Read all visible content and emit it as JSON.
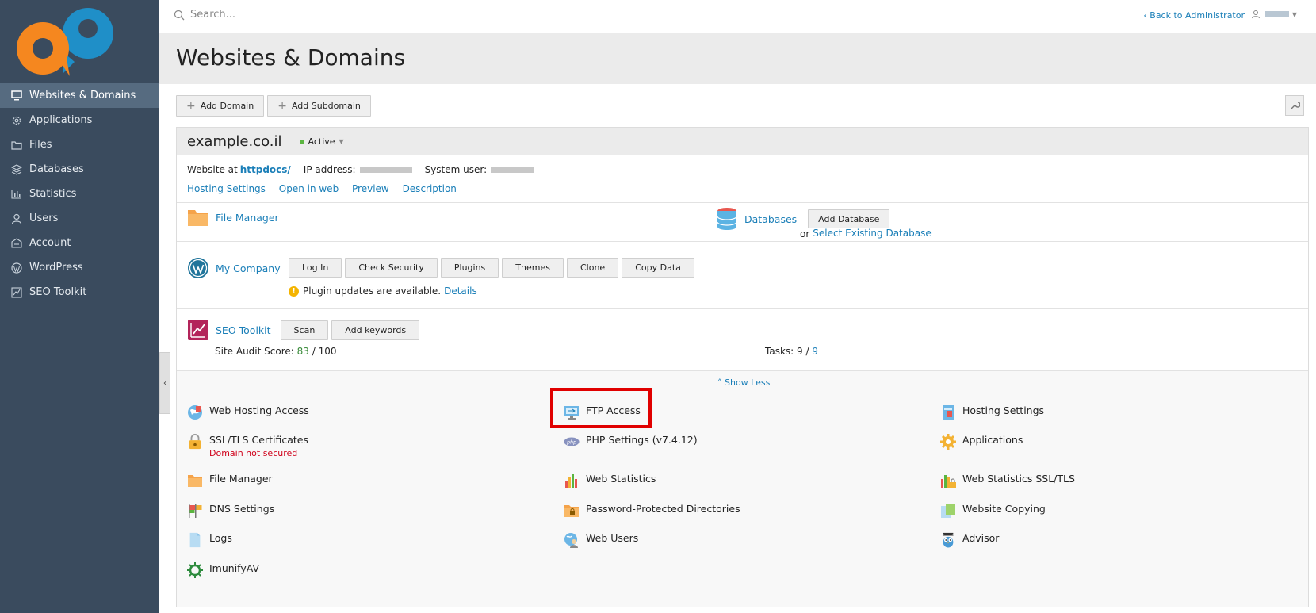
{
  "search": {
    "placeholder": "Search..."
  },
  "header": {
    "back_link": "‹ Back to Administrator"
  },
  "sidebar": {
    "items": [
      {
        "label": "Websites & Domains",
        "icon": "monitor-icon"
      },
      {
        "label": "Applications",
        "icon": "gear-icon"
      },
      {
        "label": "Files",
        "icon": "folder-icon"
      },
      {
        "label": "Databases",
        "icon": "database-icon"
      },
      {
        "label": "Statistics",
        "icon": "bar-chart-icon"
      },
      {
        "label": "Users",
        "icon": "user-icon"
      },
      {
        "label": "Account",
        "icon": "account-icon"
      },
      {
        "label": "WordPress",
        "icon": "wordpress-icon"
      },
      {
        "label": "SEO Toolkit",
        "icon": "seo-icon"
      }
    ]
  },
  "page": {
    "title": "Websites & Domains"
  },
  "toolbar": {
    "add_domain": "Add Domain",
    "add_subdomain": "Add Subdomain"
  },
  "domain": {
    "name": "example.co.il",
    "status": "Active",
    "website_at_label": "Website at",
    "website_path": "httpdocs/",
    "ip_label": "IP address:",
    "system_user_label": "System user:",
    "links": [
      "Hosting Settings",
      "Open in web",
      "Preview",
      "Description"
    ]
  },
  "tools": {
    "file_manager": "File Manager",
    "databases": "Databases",
    "add_database": "Add Database",
    "or": "or",
    "select_existing_database": "Select Existing Database"
  },
  "wordpress": {
    "site_name": "My Company",
    "buttons": [
      "Log In",
      "Check Security",
      "Plugins",
      "Themes",
      "Clone",
      "Copy Data"
    ],
    "notice": "Plugin updates are available.",
    "details": "Details"
  },
  "seo": {
    "label": "SEO Toolkit",
    "scan": "Scan",
    "add_keywords": "Add keywords",
    "audit_label": "Site Audit Score:",
    "audit_score": "83",
    "audit_total": "/ 100",
    "tasks_label": "Tasks:",
    "tasks_done": "9 /",
    "tasks_total": "9"
  },
  "show_less": "Show Less",
  "grid": {
    "col1": [
      {
        "label": "Web Hosting Access",
        "icon": "globe-icon"
      },
      {
        "label": "SSL/TLS Certificates",
        "icon": "lock-icon",
        "sub": "Domain not secured"
      },
      {
        "label": "File Manager",
        "icon": "folder-icon"
      },
      {
        "label": "DNS Settings",
        "icon": "flags-icon"
      },
      {
        "label": "Logs",
        "icon": "document-icon"
      },
      {
        "label": "ImunifyAV",
        "icon": "virus-shield-icon"
      }
    ],
    "col2": [
      {
        "label": "FTP Access",
        "icon": "ftp-monitor-icon"
      },
      {
        "label": "PHP Settings (v7.4.12)",
        "icon": "php-icon"
      },
      {
        "label": "Web Statistics",
        "icon": "bar-chart-icon"
      },
      {
        "label": "Password-Protected Directories",
        "icon": "locked-folder-icon"
      },
      {
        "label": "Web Users",
        "icon": "web-users-icon"
      }
    ],
    "col3": [
      {
        "label": "Hosting Settings",
        "icon": "server-icon"
      },
      {
        "label": "Applications",
        "icon": "gear-icon"
      },
      {
        "label": "Web Statistics SSL/TLS",
        "icon": "stats-lock-icon"
      },
      {
        "label": "Website Copying",
        "icon": "copy-icon"
      },
      {
        "label": "Advisor",
        "icon": "owl-icon"
      }
    ]
  },
  "colors": {
    "sidebar": "#3a4b5e",
    "sidebar_active": "#566b80",
    "link": "#1b7fb8",
    "highlight": "#e00000",
    "status_green": "#5bb540"
  }
}
